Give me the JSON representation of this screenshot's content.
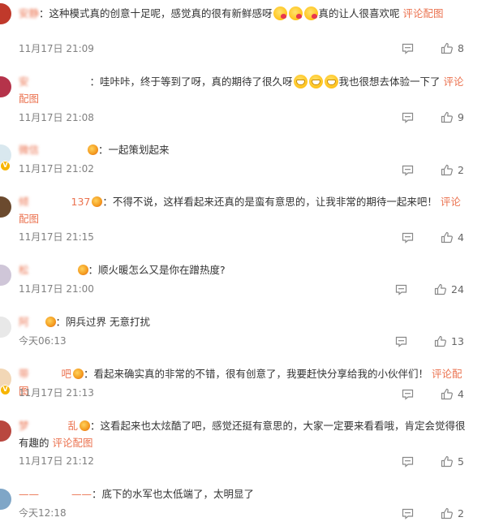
{
  "comments": [
    {
      "user": "安静",
      "text": "：这种模式真的创意十足呢，感觉真的很有新鲜感呀",
      "emojis": [
        "kiss",
        "kiss",
        "kiss"
      ],
      "text2": "真的让人很喜欢呢",
      "link": "评论配图",
      "time": "11月17日 21:09",
      "likes": "8"
    },
    {
      "user": "安",
      "text": "：哇咔咔，终于等到了呀，真的期待了很久呀",
      "emojis": [
        "grin",
        "grin",
        "grin"
      ],
      "text2": "我也很想去体验一下了",
      "link": "评论配图",
      "time": "11月17日 21:08",
      "likes": "9"
    },
    {
      "user": "微信",
      "text": "：一起策划起来",
      "link": "",
      "time": "11月17日 21:02",
      "likes": "2"
    },
    {
      "user": "倾",
      "user_suffix": "137",
      "text": "：不得不说，这样看起来还真的是蛮有意思的，让我非常的期待一起来吧！",
      "link": "评论配图",
      "time": "11月17日 21:15",
      "likes": "4"
    },
    {
      "user": "松",
      "text": "：顺火暖怎么又是你在蹭热度?",
      "link": "",
      "time": "11月17日 21:00",
      "likes": "24"
    },
    {
      "user": "阿",
      "text": "：阴兵过界 无意打扰",
      "link": "",
      "time": "今天06:13",
      "likes": "13"
    },
    {
      "user": "带",
      "user_suffix": "吧",
      "text": "：看起来确实真的非常的不错，很有创意了，我要赶快分享给我的小伙伴们！",
      "link": "评论配图",
      "time": "11月17日 21:13",
      "likes": "4"
    },
    {
      "user": "梦",
      "user_suffix": "乱",
      "text": "：这看起来也太炫酷了吧，感觉还挺有意思的，大家一定要来看看哦，肯定会觉得很有趣的",
      "link": "评论配图",
      "time": "11月17日 21:12",
      "likes": "5"
    },
    {
      "user": "——",
      "user_suffix": "——",
      "text": "：底下的水军也太低端了，太明显了",
      "link": "",
      "time": "今天12:18",
      "likes": "2"
    }
  ],
  "colors": {
    "username": "#eb7350",
    "link": "#eb7350",
    "time": "#808080"
  },
  "icons": {
    "reply": "comment-icon",
    "like": "thumb-up-icon"
  }
}
